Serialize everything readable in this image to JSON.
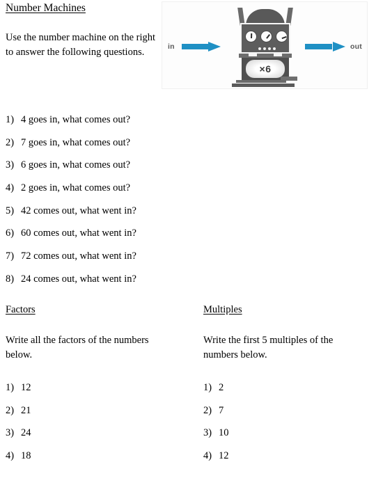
{
  "title": "Number Machines",
  "intro": "Use the number machine on the right to answer the following questions.",
  "illustration": {
    "in_label": "in",
    "out_label": "out",
    "machine_operation": "×6",
    "arrow_color": "#1f90c4",
    "machine_color": "#5d5d5d",
    "label_color": "#585858"
  },
  "questions": [
    {
      "num": "1)",
      "text": "4 goes in, what comes out?"
    },
    {
      "num": "2)",
      "text": "7 goes in, what comes out?"
    },
    {
      "num": "3)",
      "text": "6 goes in, what comes out?"
    },
    {
      "num": "4)",
      "text": "2 goes in, what comes out?"
    },
    {
      "num": "5)",
      "text": "42 comes out, what went in?"
    },
    {
      "num": "6)",
      "text": "60 comes out, what went in?"
    },
    {
      "num": "7)",
      "text": "72 comes out, what went in?"
    },
    {
      "num": "8)",
      "text": "24 comes out, what went in?"
    }
  ],
  "factors": {
    "heading": "Factors",
    "description": "Write all the factors of the numbers below.",
    "items": [
      {
        "num": "1)",
        "text": "12"
      },
      {
        "num": "2)",
        "text": "21"
      },
      {
        "num": "3)",
        "text": "24"
      },
      {
        "num": "4)",
        "text": "18"
      }
    ]
  },
  "multiples": {
    "heading": "Multiples",
    "description": "Write the first 5 multiples of the numbers below.",
    "items": [
      {
        "num": "1)",
        "text": "2"
      },
      {
        "num": "2)",
        "text": "7"
      },
      {
        "num": "3)",
        "text": "10"
      },
      {
        "num": "4)",
        "text": "12"
      }
    ]
  }
}
